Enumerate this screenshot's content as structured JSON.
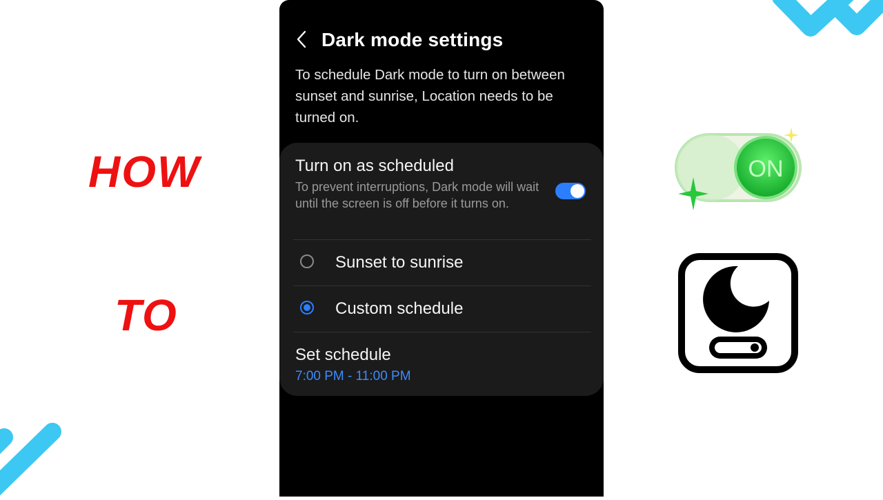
{
  "overlay": {
    "word_top": "HOW",
    "word_bottom": "TO",
    "text_color": "#ee1111"
  },
  "header": {
    "title": "Dark mode settings",
    "back_icon": "chevron-left-icon"
  },
  "description": "To schedule Dark mode to turn on between sunset and sunrise, Location needs to be turned on.",
  "schedule_toggle": {
    "title": "Turn on as scheduled",
    "subtitle": "To prevent interruptions, Dark mode will wait until the screen is off before it turns on.",
    "enabled": true
  },
  "options": [
    {
      "label": "Sunset to sunrise",
      "selected": false
    },
    {
      "label": "Custom schedule",
      "selected": true
    }
  ],
  "set_schedule": {
    "title": "Set schedule",
    "value": "7:00 PM - 11:00 PM"
  },
  "badge": {
    "label": "ON",
    "icon": "on-switch-icon"
  },
  "app_icon": "dark-mode-icon",
  "colors": {
    "accent": "#2b7fff",
    "schedule_value": "#3d8bff",
    "card_bg": "#1b1b1b",
    "deco_blue": "#3cc8f2",
    "badge_green": "#22c43a"
  }
}
